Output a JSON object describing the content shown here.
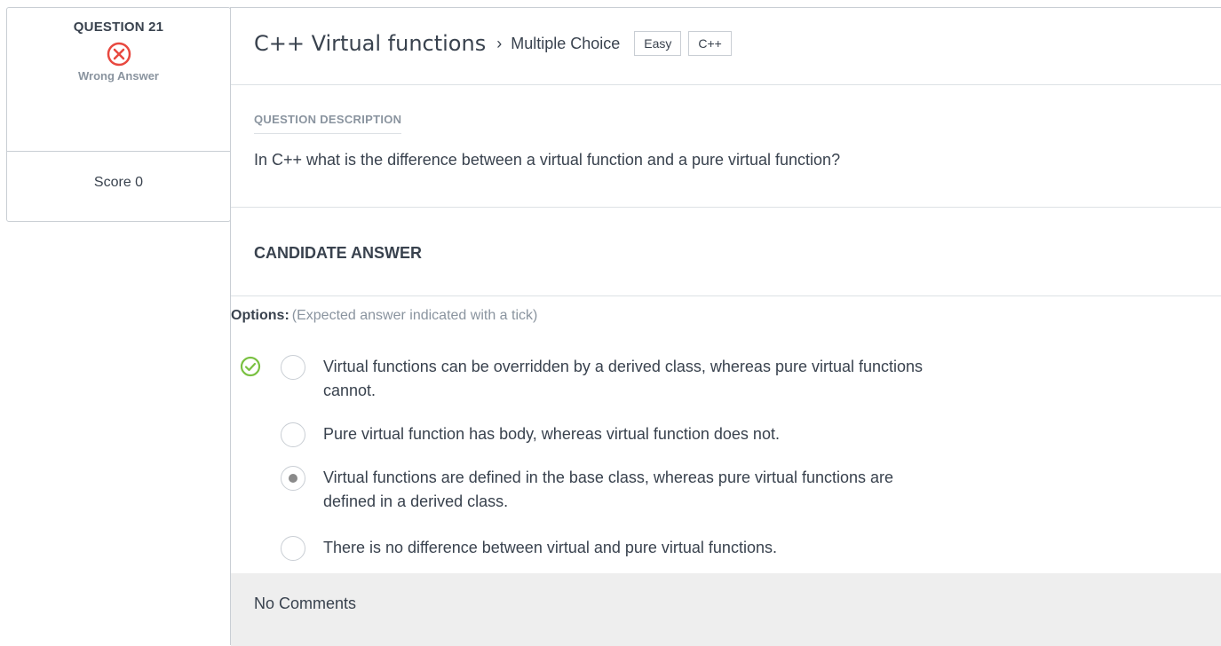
{
  "summary": {
    "question_number": "QUESTION 21",
    "status_icon": "x-circle-icon",
    "status_label": "Wrong Answer",
    "score": "Score 0"
  },
  "header": {
    "title": "C++ Virtual functions",
    "chevron": "›",
    "type": "Multiple Choice",
    "tags": [
      "Easy",
      "C++"
    ]
  },
  "description": {
    "heading": "QUESTION DESCRIPTION",
    "text": "In C++ what is the difference between a virtual function and a pure virtual function?"
  },
  "candidate": {
    "heading": "CANDIDATE ANSWER",
    "options_label": "Options:",
    "options_hint": "(Expected answer indicated with a tick)",
    "options": [
      {
        "text": "Virtual functions can be overridden by a derived class, whereas pure virtual functions cannot.",
        "expected": true,
        "selected": false
      },
      {
        "text": "Pure virtual function has body, whereas virtual function does not.",
        "expected": false,
        "selected": false
      },
      {
        "text": "Virtual functions are defined in the base class, whereas pure virtual functions are defined in a derived class.",
        "expected": false,
        "selected": true
      },
      {
        "text": "There is no difference between virtual and pure virtual functions.",
        "expected": false,
        "selected": false
      }
    ]
  },
  "comments": {
    "text": "No Comments"
  },
  "colors": {
    "wrong": "#e8483f",
    "correct": "#7ac142",
    "muted": "#8a949f",
    "text": "#39424e"
  }
}
